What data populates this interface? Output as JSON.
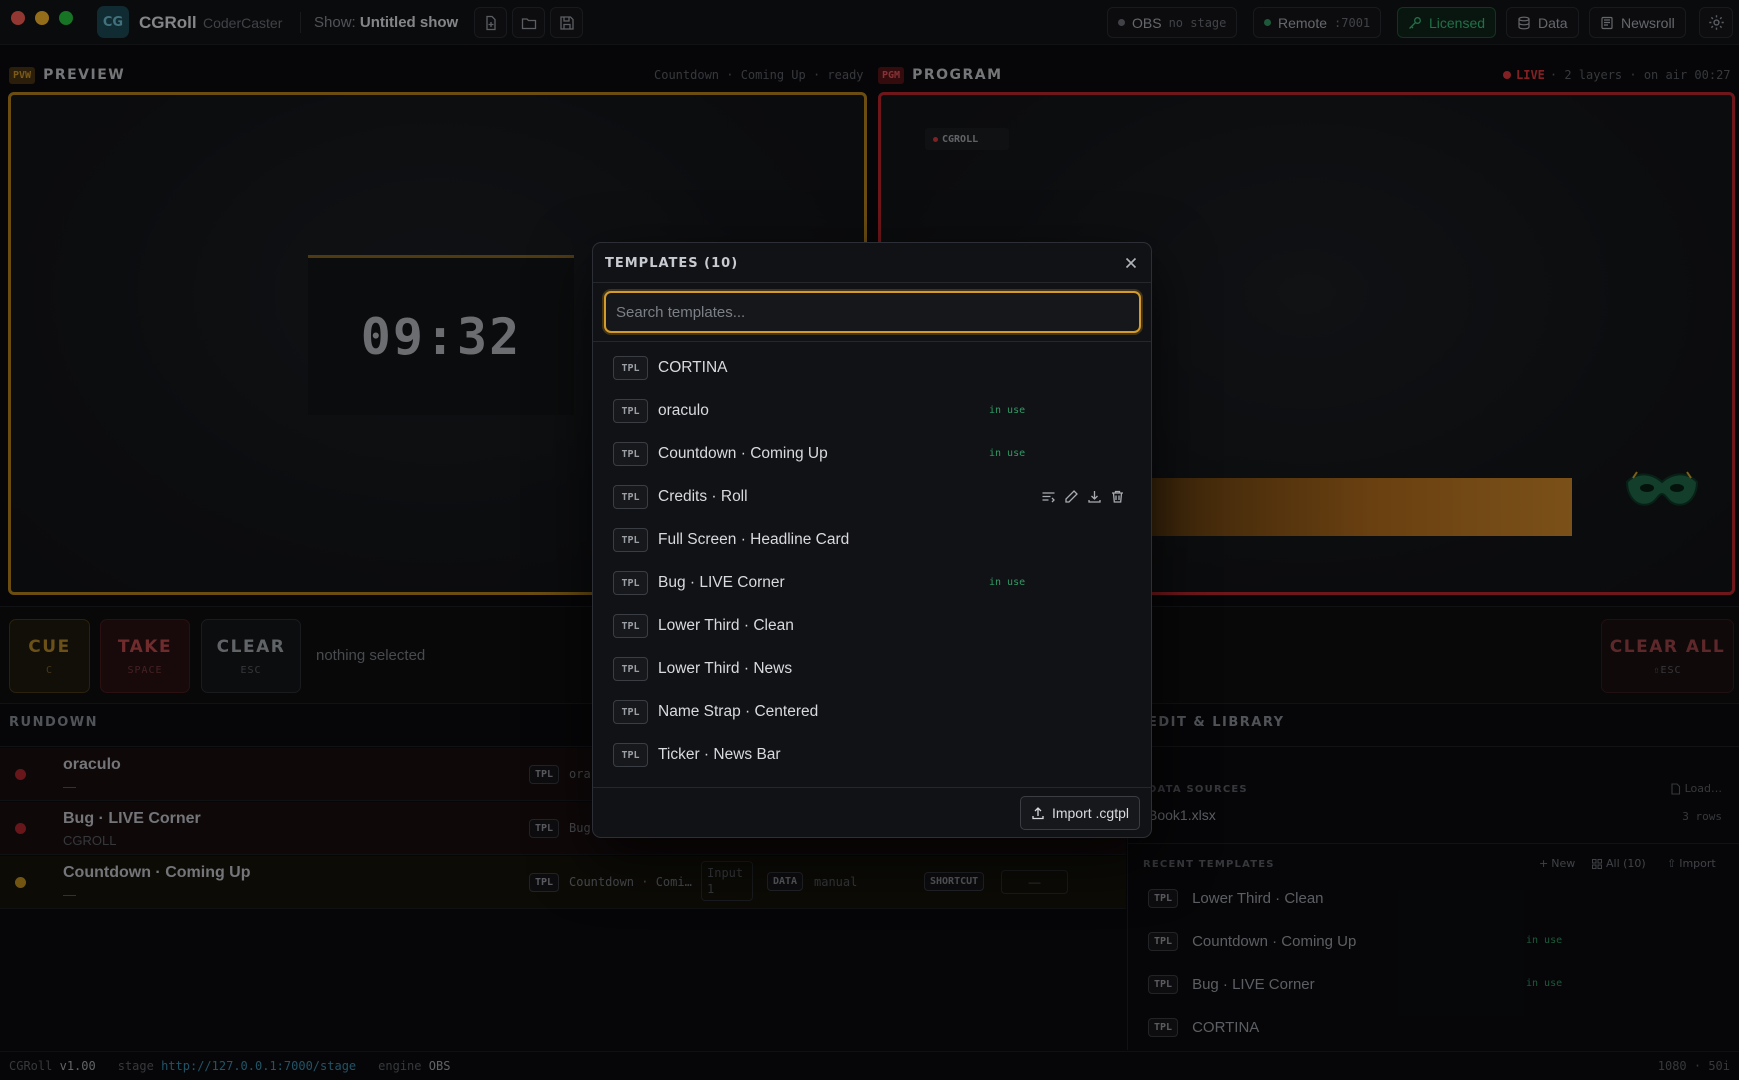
{
  "titlebar": {
    "logo": "CG",
    "app_name": "CGRoll",
    "app_sub": "CoderCaster",
    "show_label": "Show:",
    "show_name": "Untitled show",
    "obs_label": "OBS",
    "obs_status": "no stage",
    "remote_label": "Remote",
    "remote_port": ":7001",
    "licensed": "Licensed",
    "data": "Data",
    "newsroll": "Newsroll"
  },
  "preview": {
    "tag": "PVW",
    "title": "PREVIEW",
    "meta": "Countdown · Coming Up · ready",
    "countdown": "09:32"
  },
  "program": {
    "tag": "PGM",
    "title": "PROGRAM",
    "live": "LIVE",
    "meta": "· 2 layers · on air 00:27",
    "bug_text": "CGROLL"
  },
  "controls": {
    "cue": "CUE",
    "cue_key": "C",
    "take": "TAKE",
    "take_key": "SPACE",
    "clear": "CLEAR",
    "clear_key": "ESC",
    "status": "nothing selected",
    "clear_all": "CLEAR ALL",
    "clear_all_key": "⇧ESC"
  },
  "rundown": {
    "title": "RUNDOWN",
    "rows": [
      {
        "name": "oraculo",
        "sub": "—",
        "tag": "TPL",
        "tpl": "ora",
        "dot": "#b4262b"
      },
      {
        "name": "Bug · LIVE Corner",
        "sub": "CGROLL",
        "tag": "TPL",
        "tpl": "Bug",
        "dot": "#b4262b"
      },
      {
        "name": "Countdown · Coming Up",
        "sub": "—",
        "tag": "TPL",
        "tpl": "Countdown · Comi…",
        "dot": "#c79320",
        "input": "Input 1",
        "data_tag": "DATA",
        "data_val": "manual",
        "shortcut_tag": "SHORTCUT",
        "shortcut_val": "—"
      }
    ]
  },
  "library": {
    "title": "EDIT & LIBRARY",
    "data_sources": "DATA SOURCES",
    "load": "Load…",
    "file": "Book1.xlsx",
    "rows": "3 rows",
    "recent_templates": "RECENT TEMPLATES",
    "new": "New",
    "all": "All (10)",
    "import": "Import",
    "recent": [
      {
        "tag": "TPL",
        "name": "Lower Third · Clean",
        "inuse": ""
      },
      {
        "tag": "TPL",
        "name": "Countdown · Coming Up",
        "inuse": "in use"
      },
      {
        "tag": "TPL",
        "name": "Bug · LIVE Corner",
        "inuse": "in use"
      },
      {
        "tag": "TPL",
        "name": "CORTINA",
        "inuse": ""
      }
    ]
  },
  "footer": {
    "app": "CGRoll",
    "version": "v1.00",
    "stage_label": "stage",
    "stage_url": "http://127.0.0.1:7000/stage",
    "engine_label": "engine",
    "engine": "OBS",
    "res": "1080 · 50i"
  },
  "modal": {
    "title": "TEMPLATES (10)",
    "search_placeholder": "Search templates...",
    "items": [
      {
        "tag": "TPL",
        "name": "CORTINA",
        "inuse": ""
      },
      {
        "tag": "TPL",
        "name": "oraculo",
        "inuse": "in use"
      },
      {
        "tag": "TPL",
        "name": "Countdown · Coming Up",
        "inuse": "in use"
      },
      {
        "tag": "TPL",
        "name": "Credits · Roll",
        "inuse": ""
      },
      {
        "tag": "TPL",
        "name": "Full Screen · Headline Card",
        "inuse": ""
      },
      {
        "tag": "TPL",
        "name": "Bug · LIVE Corner",
        "inuse": "in use"
      },
      {
        "tag": "TPL",
        "name": "Lower Third · Clean",
        "inuse": ""
      },
      {
        "tag": "TPL",
        "name": "Lower Third · News",
        "inuse": ""
      },
      {
        "tag": "TPL",
        "name": "Name Strap · Centered",
        "inuse": ""
      },
      {
        "tag": "TPL",
        "name": "Ticker · News Bar",
        "inuse": ""
      }
    ],
    "import_label": "Import .cgtpl"
  },
  "icons": [
    "new-file-icon",
    "open-folder-icon",
    "save-icon",
    "key-icon",
    "database-icon",
    "newspaper-icon",
    "gear-icon",
    "close-icon",
    "upload-icon",
    "rename-icon",
    "edit-icon",
    "download-icon",
    "trash-icon",
    "plus-icon",
    "grid-icon",
    "file-icon",
    "mask-icon"
  ],
  "colors": {
    "accent": "#d49b2a",
    "live": "#c0272d",
    "ok": "#2f9a64",
    "bg": "#0b0c0e"
  }
}
